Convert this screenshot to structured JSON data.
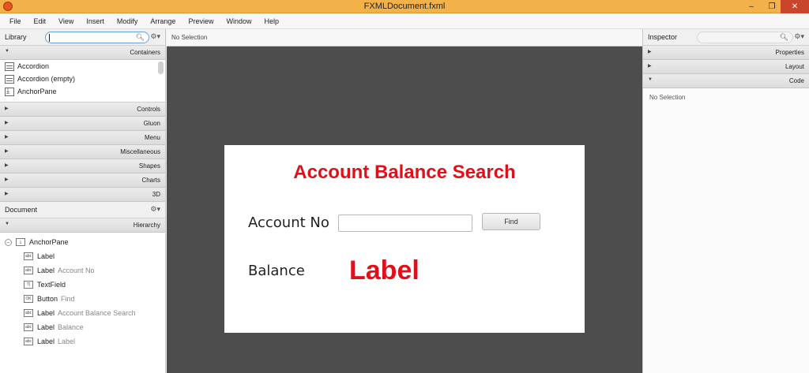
{
  "window": {
    "title": "FXMLDocument.fxml",
    "min": "‒",
    "max": "❐",
    "close": "✕"
  },
  "menu": [
    "File",
    "Edit",
    "View",
    "Insert",
    "Modify",
    "Arrange",
    "Preview",
    "Window",
    "Help"
  ],
  "library": {
    "title": "Library",
    "search_placeholder": "",
    "sections": {
      "containers": "Containers",
      "controls": "Controls",
      "gluon": "Gluon",
      "menu": "Menu",
      "misc": "Miscellaneous",
      "shapes": "Shapes",
      "charts": "Charts",
      "three_d": "3D"
    },
    "items": [
      "Accordion",
      "Accordion  (empty)",
      "AnchorPane"
    ]
  },
  "document": {
    "title": "Document",
    "hierarchy_label": "Hierarchy",
    "root": "AnchorPane",
    "nodes": [
      {
        "icon": "abc",
        "type": "Label",
        "value": ""
      },
      {
        "icon": "abc",
        "type": "Label",
        "value": "Account No"
      },
      {
        "icon": "T|",
        "type": "TextField",
        "value": ""
      },
      {
        "icon": "OK",
        "type": "Button",
        "value": "Find"
      },
      {
        "icon": "abc",
        "type": "Label",
        "value": "Account Balance Search"
      },
      {
        "icon": "abc",
        "type": "Label",
        "value": "Balance"
      },
      {
        "icon": "abc",
        "type": "Label",
        "value": "Label"
      }
    ]
  },
  "center": {
    "selection": "No Selection",
    "form": {
      "heading": "Account Balance Search",
      "account_label": "Account No",
      "account_value": "",
      "find_button": "Find",
      "balance_label": "Balance",
      "balance_value": "Label"
    }
  },
  "inspector": {
    "title": "Inspector",
    "sections": {
      "properties": "Properties",
      "layout": "Layout",
      "code": "Code"
    },
    "selection": "No Selection"
  },
  "colors": {
    "accent_red": "#e0101a",
    "titlebar": "#f3b14a",
    "canvas_bg": "#4d4d4d"
  }
}
